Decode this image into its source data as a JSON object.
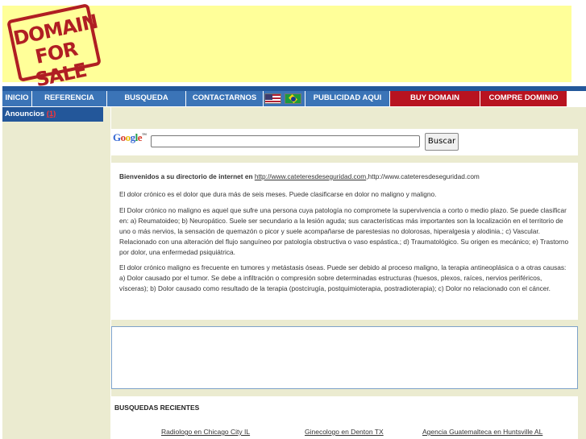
{
  "header": {
    "stamp_line1": "DOMAIN",
    "stamp_line2": "FOR SALE"
  },
  "nav": {
    "inicio": "INICIO",
    "referencia": "REFERENCIA",
    "busqueda": "BUSQUEDA",
    "contactarnos": "CONTACTARNOS",
    "publicidad": "PUBLICIDAD AQUI",
    "buy_domain": "BUY DOMAIN",
    "compre_dominio": "COMPRE DOMINIO",
    "flags": [
      "us-flag-icon",
      "brazil-flag-icon"
    ]
  },
  "sidebar": {
    "anuncios_label": "Anouncios",
    "anuncios_count": "(1)"
  },
  "search": {
    "logo": "Google",
    "logo_tm": "™",
    "query_value": "",
    "button_label": "Buscar"
  },
  "content": {
    "welcome_bold": "Bienvenidos a su directorio de internet en",
    "welcome_link": "http://www.cateteresdeseguridad.com",
    "welcome_rest": ",http://www.cateteresdeseguridad.com",
    "p1": "El dolor crónico es el dolor que dura más de seis meses. Puede clasificarse en dolor no maligno y maligno.",
    "p2": "El Dolor crónico no maligno es aquel que sufre una persona cuya patología no compromete la supervivencia a corto o medio plazo. Se puede clasificar en: a) Reumatoideo; b) Neuropático. Suele ser secundario a la lesión aguda; sus características más importantes son la localización en el territorio de uno o más nervios, la sensación de quemazón o picor y suele acompañarse de parestesias no dolorosas, hiperalgesia y alodinia.; c) Vascular. Relacionado con una alteración del flujo sanguíneo por patología obstructiva o vaso espástica.; d) Traumatológico. Su origen es mecánico; e) Trastorno por dolor, una enfermedad psiquiátrica.",
    "p3": "El dolor crónico maligno es frecuente en tumores y metástasis óseas. Puede ser debido al proceso maligno, la terapia antineoplásica o a otras causas:  a) Dolor causado por el tumor. Se debe a infiltración o compresión sobre determinadas estructuras (huesos, plexos, raíces, nervios periféricos, vísceras); b) Dolor causado como resultado de la terapia (postcirugía, postquimioterapia, postradioterapia); c) Dolor no relacionado con el cáncer."
  },
  "recent": {
    "title": "BUSQUEDAS RECIENTES",
    "links": [
      "Radiologo en Chicago City IL",
      "Ginecologo en Denton TX",
      "Agencia Guatemalteca en Huntsville AL"
    ]
  },
  "colors": {
    "header_bg": "#ffff99",
    "nav_blue": "#3b74b7",
    "nav_red": "#b81320",
    "side_bg": "#ebebd0",
    "stamp_red": "#b01e23"
  }
}
